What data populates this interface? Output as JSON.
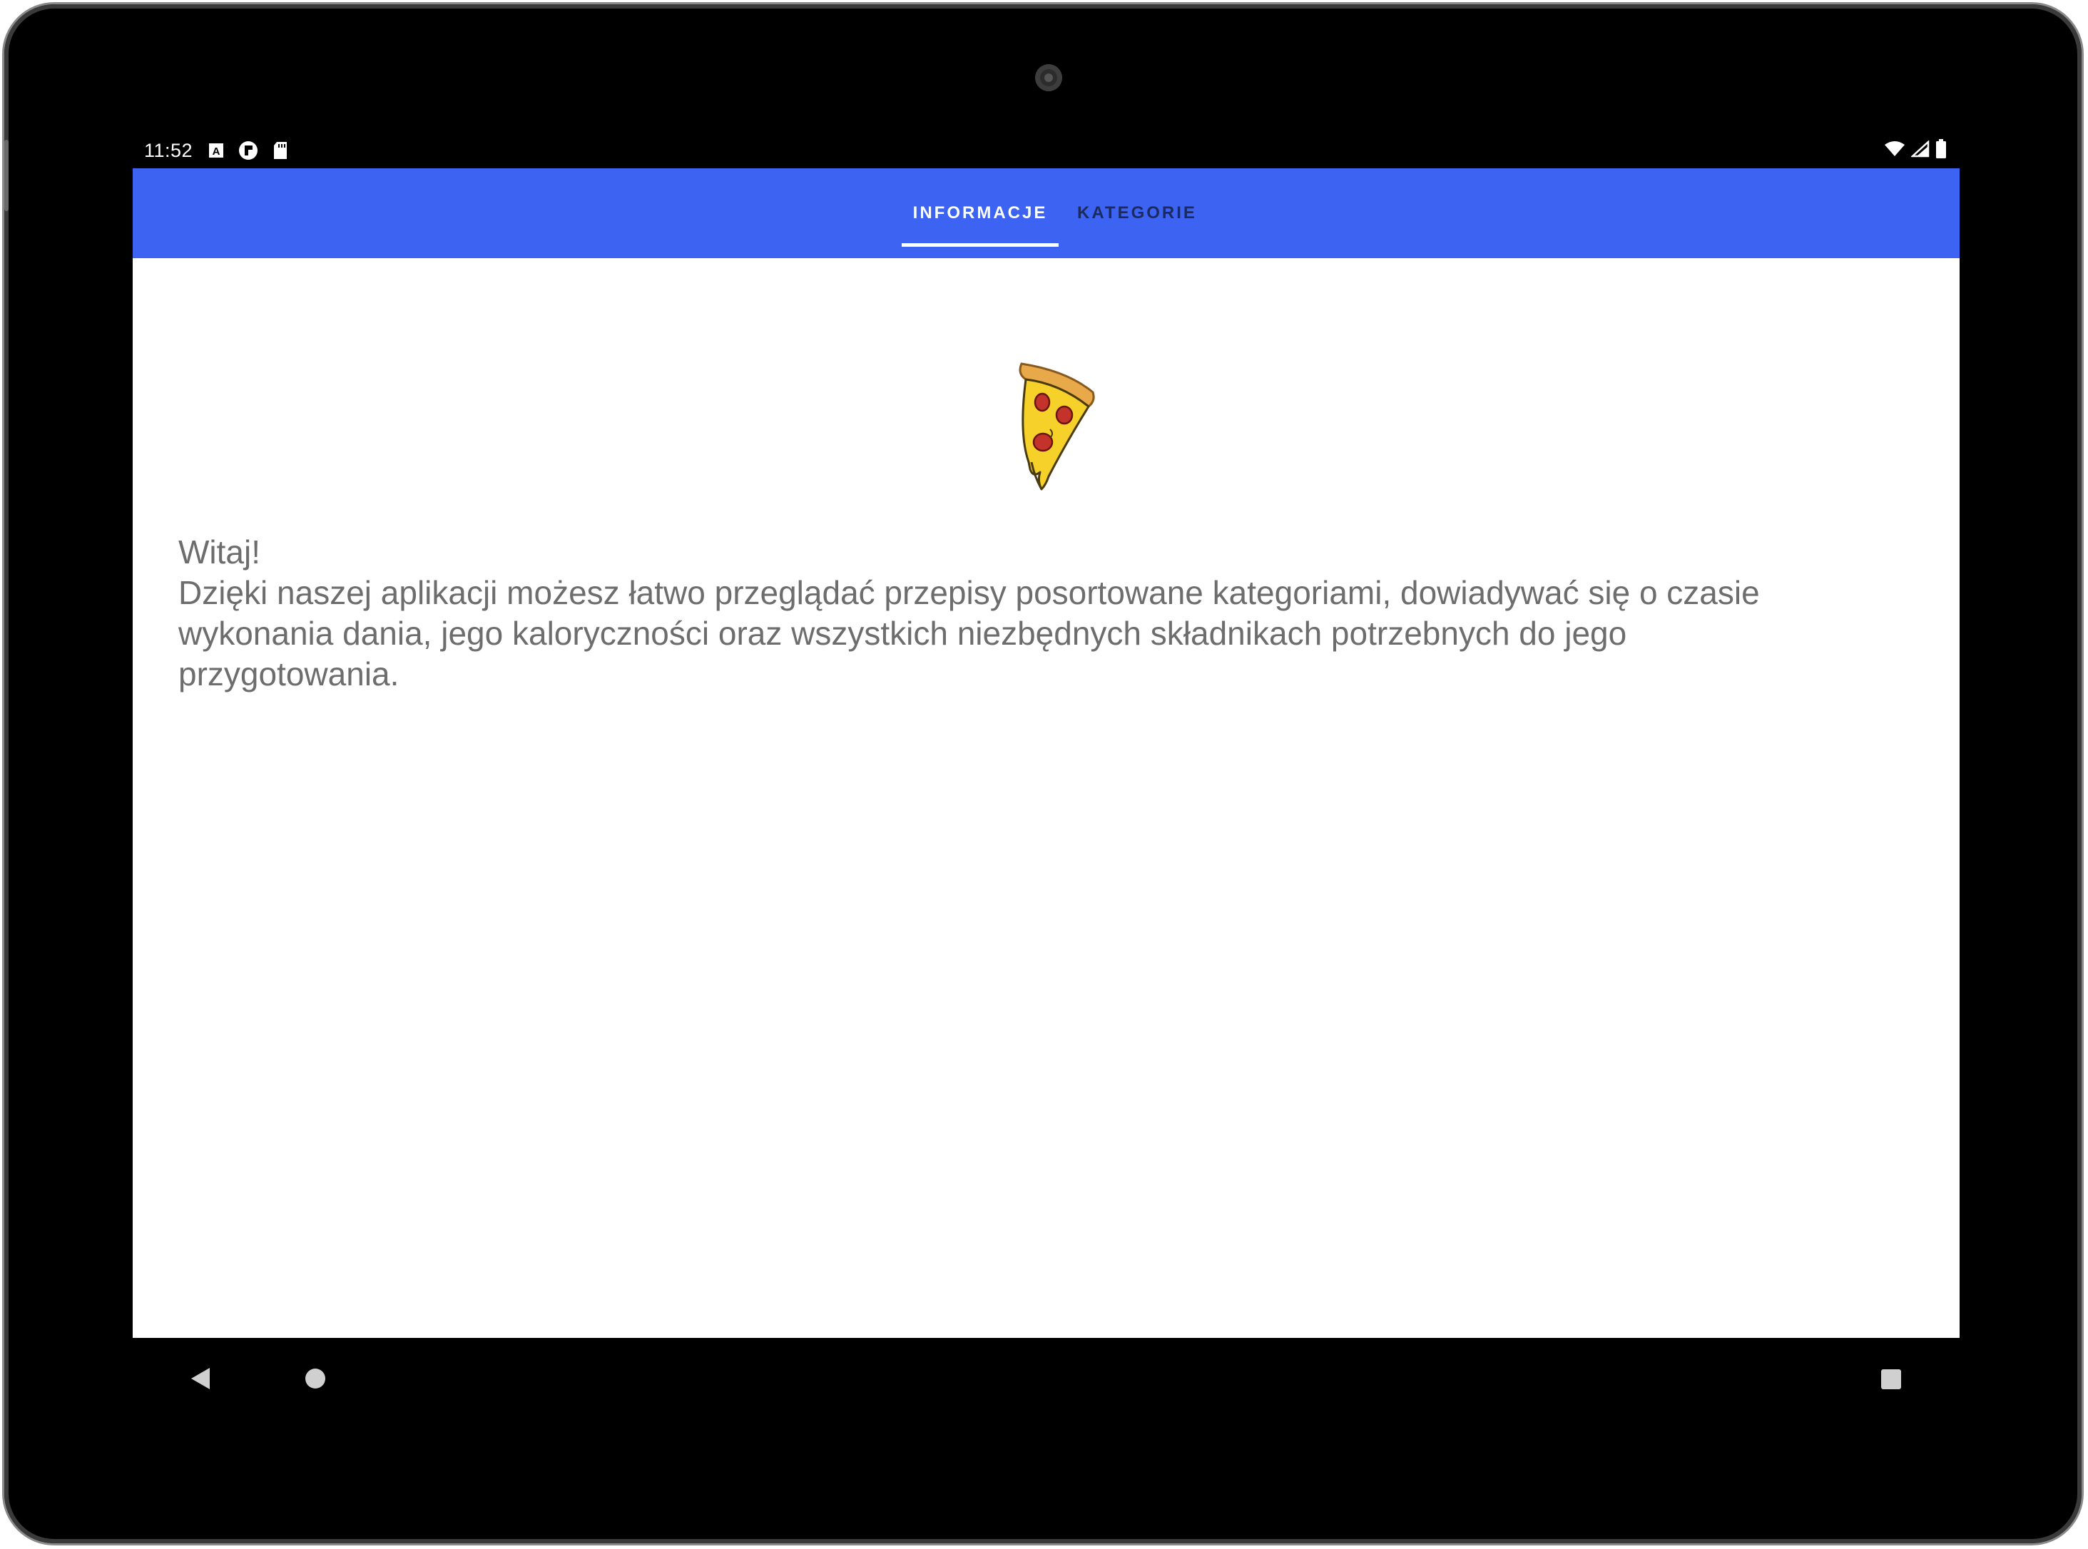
{
  "status_bar": {
    "time": "11:52",
    "left_icons": [
      "keyboard-a-icon",
      "notification-circle-icon",
      "sd-card-icon"
    ],
    "right_icons": [
      "wifi-icon",
      "cell-signal-icon",
      "battery-icon"
    ]
  },
  "tabs": [
    {
      "label": "INFORMACJE",
      "active": true
    },
    {
      "label": "KATEGORIE",
      "active": false
    }
  ],
  "content": {
    "image": "pizza-slice",
    "greeting": "Witaj!",
    "body": "Dzięki naszej aplikacji możesz łatwo przeglądać przepisy posortowane kategoriami, dowiadywać się o czasie wykonania dania, jego kaloryczności oraz wszystkich niezbędnych składnikach potrzebnych do jego przygotowania."
  },
  "nav_bar": [
    "back-icon",
    "home-icon",
    "recents-icon"
  ],
  "colors": {
    "toolbar": "#3c63f1",
    "tab_active": "#ffffff",
    "tab_inactive": "#1c2a5e",
    "text": "#6d6d6d"
  }
}
